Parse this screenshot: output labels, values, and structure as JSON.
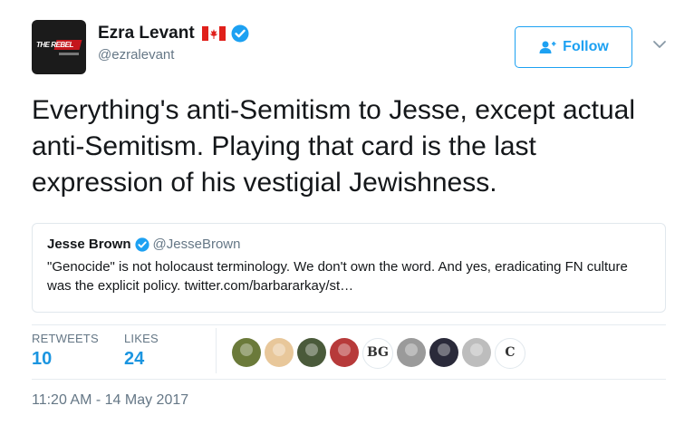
{
  "author": {
    "display_name": "Ezra Levant",
    "handle": "@ezralevant",
    "avatar_text": "THE REBEL",
    "flag": "canada-flag-icon",
    "verified": true
  },
  "follow_button": {
    "label": "Follow",
    "icon": "add-user-icon"
  },
  "tweet": {
    "text": "Everything's anti-Semitism to Jesse, except actual anti-Semitism. Playing that card is the last expression of his vestigial Jewishness."
  },
  "quoted_tweet": {
    "display_name": "Jesse Brown",
    "handle": "@JesseBrown",
    "verified": true,
    "text": "\"Genocide\" is not holocaust terminology. We don't own the word. And yes, eradicating FN culture was the explicit policy. twitter.com/barbararkay/st…"
  },
  "stats": {
    "retweets_label": "RETWEETS",
    "retweets_count": "10",
    "likes_label": "LIKES",
    "likes_count": "24"
  },
  "likers": [
    {
      "color": "#6b7a3a"
    },
    {
      "color": "#e8c79a"
    },
    {
      "color": "#4a5a3a"
    },
    {
      "color": "#b73a3a"
    },
    {
      "color": "#ffffff",
      "text": "BG"
    },
    {
      "color": "#9a9a9a"
    },
    {
      "color": "#2a2a3a"
    },
    {
      "color": "#bdbdbd"
    },
    {
      "color": "#ffffff",
      "text": "C"
    }
  ],
  "timestamp": "11:20 AM - 14 May 2017",
  "colors": {
    "accent": "#1da1f2",
    "link": "#1b95e0",
    "muted": "#657786"
  }
}
